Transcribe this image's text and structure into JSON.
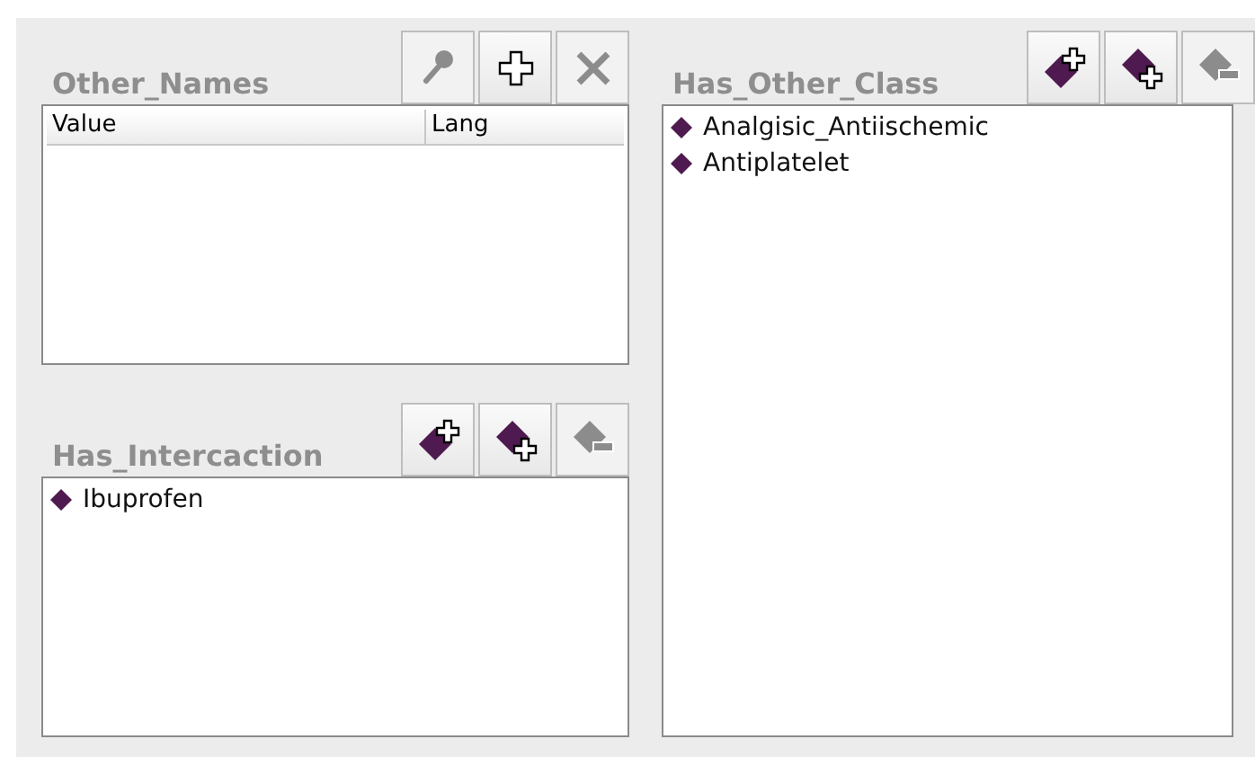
{
  "panels": [
    {
      "title": "Other_Names",
      "kind": "table",
      "buttons": [
        {
          "kind": "search",
          "disabled": true
        },
        {
          "kind": "add",
          "disabled": false
        },
        {
          "kind": "delete",
          "disabled": true
        }
      ],
      "columns": [
        "Value",
        "Lang"
      ]
    },
    {
      "title": "Has_Intercaction",
      "kind": "list",
      "buttons": [
        {
          "kind": "add-sub",
          "disabled": false
        },
        {
          "kind": "add-class",
          "disabled": false
        },
        {
          "kind": "remove",
          "disabled": true
        }
      ],
      "items": [
        "Ibuprofen"
      ]
    },
    {
      "title": "Has_Other_Class",
      "kind": "list",
      "buttons": [
        {
          "kind": "add-sub",
          "disabled": false
        },
        {
          "kind": "add-class",
          "disabled": false
        },
        {
          "kind": "remove",
          "disabled": true
        }
      ],
      "items": [
        "Analgisic_Antiischemic",
        "Antiplatelet"
      ]
    }
  ]
}
